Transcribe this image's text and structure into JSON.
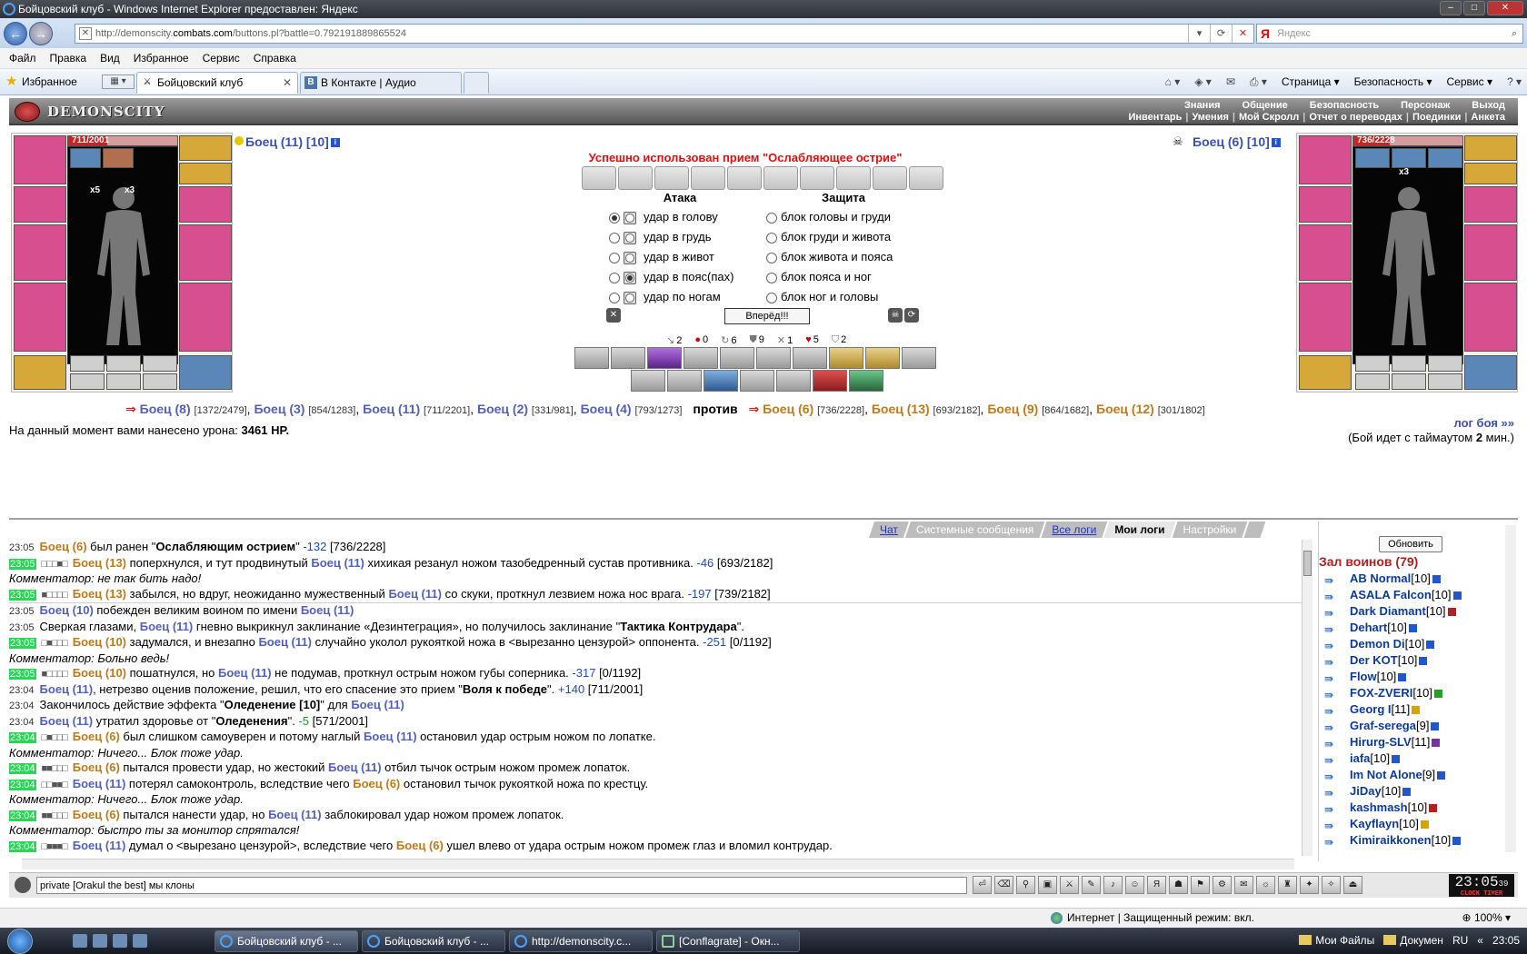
{
  "window": {
    "title": "Бойцовский клуб - Windows Internet Explorer предоставлен: Яндекс"
  },
  "address": {
    "prefix": "http://demonscity.",
    "domain": "combats.com",
    "path": "/buttons.pl?battle=0.792191889865524",
    "search_placeholder": "Яндекс",
    "search_logo": "Я"
  },
  "menu": [
    "Файл",
    "Правка",
    "Вид",
    "Избранное",
    "Сервис",
    "Справка"
  ],
  "tabs": {
    "favorites": "Избранное",
    "tab1": "Бойцовский клуб",
    "tab2": "В Контакте | Аудио",
    "tab2_icon": "В"
  },
  "commands": {
    "page": "Страница",
    "security": "Безопасность",
    "service": "Сервис"
  },
  "game": {
    "logo": "DEMONSCITY",
    "nav_top": [
      "Знания",
      "Общение",
      "Безопасность",
      "Персонаж",
      "Выход"
    ],
    "nav_bottom": [
      "Инвентарь",
      "Умения",
      "Мой Скролл",
      "Отчет о переводах",
      "Поединки",
      "Анкета"
    ]
  },
  "left_fighter": {
    "name": "Боец (11) [10]",
    "hp_text": "711/2001",
    "hp_fraction": 0.355,
    "mult1": "x5",
    "mult2": "x3"
  },
  "right_fighter": {
    "name": "Боец (6) [10]",
    "hp_text": "736/2228",
    "hp_fraction": 0.33,
    "mult1": "x3"
  },
  "combat": {
    "message": "Успешно использован прием \"Ослабляющее острие\"",
    "attack_title": "Атака",
    "defense_title": "Защита",
    "attacks": [
      "удар в голову",
      "удар в грудь",
      "удар в живот",
      "удар в пояс(пах)",
      "удар по ногам"
    ],
    "defenses": [
      "блок головы и груди",
      "блок груди и живота",
      "блок живота и пояса",
      "блок пояса и ног",
      "блок ног и головы"
    ],
    "go_button": "Вперёд!!!",
    "stats": [
      "2",
      "0",
      "6",
      "9",
      "1",
      "5",
      "2"
    ],
    "damage_label": "На данный момент вами нанесено урона:",
    "damage_value": "3461 HP.",
    "log_link": "лог боя »»",
    "timeout": "(Бой идет с таймаутом",
    "timeout_value": "2",
    "timeout_suffix": "мин.)"
  },
  "teams": {
    "left": [
      {
        "name": "Боец (8)",
        "hp": "[1372/2479]"
      },
      {
        "name": "Боец (3)",
        "hp": "[854/1283]"
      },
      {
        "name": "Боец (11)",
        "hp": "[711/2201]"
      },
      {
        "name": "Боец (2)",
        "hp": "[331/981]"
      },
      {
        "name": "Боец (4)",
        "hp": "[793/1273]"
      }
    ],
    "vs": "против",
    "right": [
      {
        "name": "Боец (6)",
        "hp": "[736/2228]"
      },
      {
        "name": "Боец (13)",
        "hp": "[693/2182]"
      },
      {
        "name": "Боец (9)",
        "hp": "[864/1682]"
      },
      {
        "name": "Боец (12)",
        "hp": "[301/1802]"
      }
    ]
  },
  "chat_tabs": [
    "Чат",
    "Системные сообщения",
    "Все логи",
    "Мои логи",
    "Настройки"
  ],
  "chat_input": "private [Orakul the best] мы клоны",
  "online": {
    "refresh": "Обновить",
    "title": "Зал воинов (79)",
    "users": [
      {
        "name": "AB Normal",
        "level": "[10]"
      },
      {
        "name": "ASALA Falcon",
        "level": "[10]"
      },
      {
        "name": "Dark Diamant",
        "level": "[10]"
      },
      {
        "name": "Dehart",
        "level": "[10]"
      },
      {
        "name": "Demon Di",
        "level": "[10]"
      },
      {
        "name": "Der KOT",
        "level": "[10]"
      },
      {
        "name": "Flow",
        "level": "[10]"
      },
      {
        "name": "FOX-ZVERI",
        "level": "[10]"
      },
      {
        "name": "Georg I",
        "level": "[11]"
      },
      {
        "name": "Graf-serega",
        "level": "[9]"
      },
      {
        "name": "Hirurg-SLV",
        "level": "[11]"
      },
      {
        "name": "iafa",
        "level": "[10]"
      },
      {
        "name": "Im Not Alone",
        "level": "[9]"
      },
      {
        "name": "JiDay",
        "level": "[10]"
      },
      {
        "name": "kashmash",
        "level": "[10]"
      },
      {
        "name": "Kayflayn",
        "level": "[10]"
      },
      {
        "name": "Kimiraikkonen",
        "level": "[10]"
      }
    ]
  },
  "clock": {
    "time": "23:05",
    "sec": "39",
    "label": "CLOCK TIMER"
  },
  "status": {
    "zone": "Интернет | Защищенный режим: вкл.",
    "zoom": "100%"
  },
  "taskbar": {
    "buttons": [
      "Бойцовский клуб - ...",
      "Бойцовский клуб - ...",
      "http://demonscity.c...",
      "[Conflagrate] - Окн..."
    ],
    "folders": [
      "Мои Файлы",
      "Докумен"
    ],
    "lang": "RU",
    "time": "23:05"
  }
}
